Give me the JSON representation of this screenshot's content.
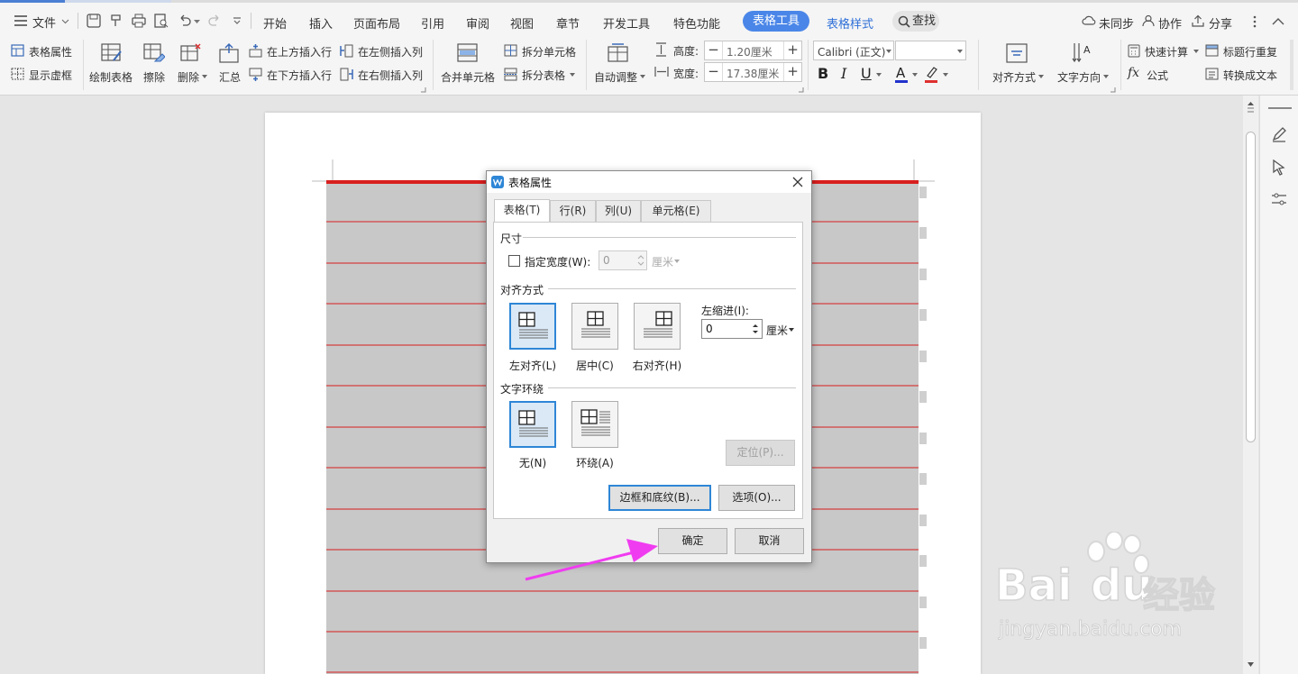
{
  "menubar": {
    "file": "文件",
    "tabs": [
      "开始",
      "插入",
      "页面布局",
      "引用",
      "审阅",
      "视图",
      "章节",
      "开发工具",
      "特色功能"
    ],
    "active_tab": "表格工具",
    "tab_table_style": "表格样式",
    "search": "查找",
    "sync": "未同步",
    "collab": "协作",
    "share": "分享"
  },
  "ribbon": {
    "table_props": "表格属性",
    "show_gridlines": "显示虚框",
    "draw_table": "绘制表格",
    "erase": "擦除",
    "delete": "删除",
    "summary": "汇总",
    "insert_row_above": "在上方插入行",
    "insert_row_below": "在下方插入行",
    "insert_col_left": "在左侧插入列",
    "insert_col_right": "在右侧插入列",
    "merge_cells": "合并单元格",
    "split_cells": "拆分单元格",
    "split_table": "拆分表格",
    "auto_fit": "自动调整",
    "height_label": "高度:",
    "height_value": "1.20厘米",
    "width_label": "宽度:",
    "width_value": "17.38厘米",
    "font_name": "Calibri (正文)",
    "font_size": "",
    "bold": "B",
    "italic": "I",
    "underline": "U",
    "font_color": "A",
    "align": "对齐方式",
    "text_direction": "文字方向",
    "quick_calc": "快速计算",
    "formula": "公式",
    "repeat_header": "标题行重复",
    "convert_text": "转换成文本"
  },
  "dialog": {
    "title": "表格属性",
    "tabs": [
      "表格(T)",
      "行(R)",
      "列(U)",
      "单元格(E)"
    ],
    "size_group": "尺寸",
    "specify_width": "指定宽度(W):",
    "width_value": "0",
    "width_unit": "厘米",
    "align_group": "对齐方式",
    "align_left": "左对齐(L)",
    "align_center": "居中(C)",
    "align_right": "右对齐(H)",
    "left_indent": "左缩进(I):",
    "indent_value": "0",
    "indent_unit": "厘米",
    "wrap_group": "文字环绕",
    "wrap_none": "无(N)",
    "wrap_around": "环绕(A)",
    "position_btn": "定位(P)...",
    "borders_btn": "边框和底纹(B)...",
    "options_btn": "选项(O)...",
    "ok_btn": "确定",
    "cancel_btn": "取消"
  },
  "watermark": {
    "brand": "Bai",
    "brand2": "du",
    "brand3": "经验",
    "url": "jingyan.baidu.com"
  },
  "colors": {
    "accent": "#4a7fd4",
    "table_fill": "#c8c8c8",
    "table_line": "#d81e1e",
    "arrow": "#f03cf0",
    "selection": "#2e86d6"
  }
}
